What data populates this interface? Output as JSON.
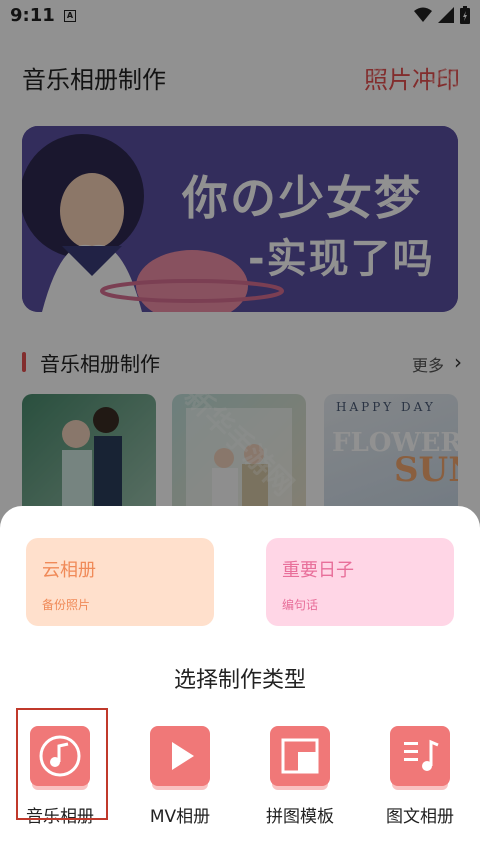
{
  "status": {
    "time": "9:11",
    "notif_letter": "A"
  },
  "header": {
    "title": "音乐相册制作",
    "link": "照片冲印"
  },
  "banner": {
    "line1": "你の少女梦",
    "line2": "-实现了吗"
  },
  "section": {
    "title": "音乐相册制作",
    "more": "更多"
  },
  "thumbs": {
    "t3_top": "HAPPY DAY",
    "t3_big": "FLOWER",
    "t3_sun": "SUN"
  },
  "sheet": {
    "cards": [
      {
        "title": "云相册",
        "sub": "备份照片"
      },
      {
        "title": "重要日子",
        "sub": "编句话"
      }
    ],
    "choose_title": "选择制作类型",
    "types": [
      {
        "label": "音乐相册",
        "icon": "music-note-icon"
      },
      {
        "label": "MV相册",
        "icon": "play-icon"
      },
      {
        "label": "拼图模板",
        "icon": "puzzle-layout-icon"
      },
      {
        "label": "图文相册",
        "icon": "text-photo-icon"
      }
    ]
  },
  "watermark": "新华手游网",
  "colors": {
    "accent": "#f07878",
    "header_link": "#e55050",
    "highlight": "#c0392b"
  }
}
